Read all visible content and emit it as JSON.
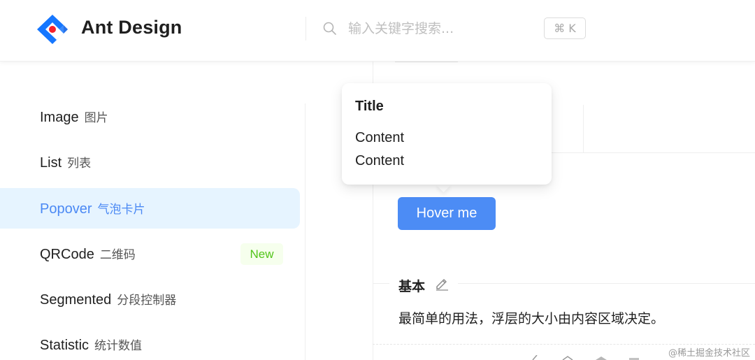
{
  "header": {
    "brand": "Ant Design",
    "search": {
      "placeholder": "输入关键字搜索...",
      "value": ""
    },
    "shortcut": "⌘ K",
    "logo_colors": {
      "blue": "#1677ff",
      "red": "#f5222d"
    }
  },
  "menu": {
    "items": [
      {
        "en": "Image",
        "zh": "图片",
        "selected": false
      },
      {
        "en": "List",
        "zh": "列表",
        "selected": false
      },
      {
        "en": "Popover",
        "zh": "气泡卡片",
        "selected": true
      },
      {
        "en": "QRCode",
        "zh": "二维码",
        "badge": "New",
        "selected": false
      },
      {
        "en": "Segmented",
        "zh": "分段控制器",
        "selected": false
      },
      {
        "en": "Statistic",
        "zh": "统计数值",
        "selected": false
      }
    ]
  },
  "popover": {
    "title": "Title",
    "lines": [
      "Content",
      "Content"
    ]
  },
  "demo": {
    "button_label": "Hover me",
    "section_title": "基本",
    "description": "最简单的用法，浮层的大小由内容区域决定。"
  },
  "watermark": "@稀土掘金技术社区",
  "colors": {
    "primary": "#4c8cf5",
    "selected_bg": "#e6f4ff",
    "new_badge": "#52c41a"
  }
}
